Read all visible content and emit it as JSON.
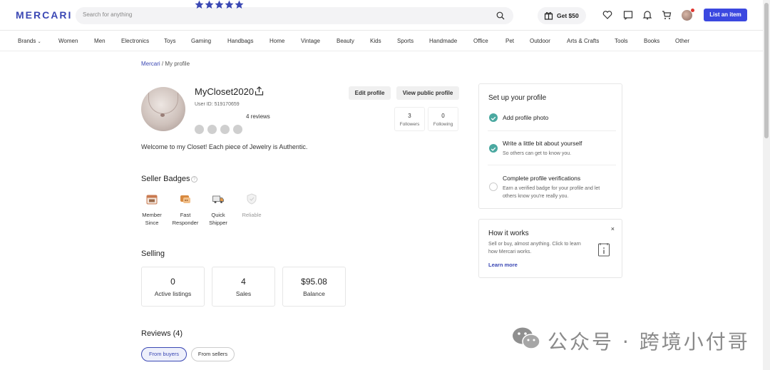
{
  "header": {
    "logo": "MERCARI",
    "search_placeholder": "Search for anything",
    "get_reward_label": "Get $50",
    "list_item_label": "List an item"
  },
  "categories": [
    "Brands",
    "Women",
    "Men",
    "Electronics",
    "Toys",
    "Gaming",
    "Handbags",
    "Home",
    "Vintage",
    "Beauty",
    "Kids",
    "Sports",
    "Handmade",
    "Office",
    "Pet",
    "Outdoor",
    "Arts & Crafts",
    "Tools",
    "Books",
    "Other"
  ],
  "breadcrumb": {
    "root": "Mercari",
    "separator": " / ",
    "current": "My profile"
  },
  "profile": {
    "username": "MyCloset2020",
    "user_id": "User ID: 519170659",
    "rating_stars": 5,
    "reviews_label": "4 reviews",
    "edit_label": "Edit profile",
    "public_label": "View public profile",
    "followers_count": "3",
    "followers_label": "Followers",
    "following_count": "0",
    "following_label": "Following",
    "bio": "Welcome to my Closet! Each piece of Jewelry is Authentic."
  },
  "seller_badges": {
    "title": "Seller Badges",
    "items": [
      {
        "line1": "Member",
        "line2": "Since",
        "icon": "calendar-icon"
      },
      {
        "line1": "Fast",
        "line2": "Responder",
        "icon": "chat-icon"
      },
      {
        "line1": "Quick",
        "line2": "Shipper",
        "icon": "truck-icon"
      },
      {
        "line1": "Reliable",
        "line2": "",
        "icon": "shield-icon"
      }
    ]
  },
  "selling": {
    "title": "Selling",
    "stats": [
      {
        "value": "0",
        "label": "Active listings"
      },
      {
        "value": "4",
        "label": "Sales"
      },
      {
        "value": "$95.08",
        "label": "Balance"
      }
    ]
  },
  "reviews": {
    "title": "Reviews (4)",
    "from_buyers": "From buyers",
    "from_sellers": "From sellers"
  },
  "setup": {
    "title": "Set up your profile",
    "steps": [
      {
        "title": "Add profile photo",
        "sub": ""
      },
      {
        "title": "Write a little bit about yourself",
        "sub": "So others can get to know you."
      },
      {
        "title": "Complete profile verifications",
        "sub": "Earn a verified badge for your profile and let others know you're really you."
      }
    ]
  },
  "how_it_works": {
    "title": "How it works",
    "text": "Sell or buy, almost anything. Click to learn how Mercari works.",
    "link": "Learn more",
    "close": "×"
  },
  "watermark": {
    "text": "公众号 · 跨境小付哥"
  },
  "colors": {
    "brand": "#3b48b4",
    "accent": "#3b48e0",
    "check": "#4aa8a0",
    "star": "#3b48b4"
  }
}
